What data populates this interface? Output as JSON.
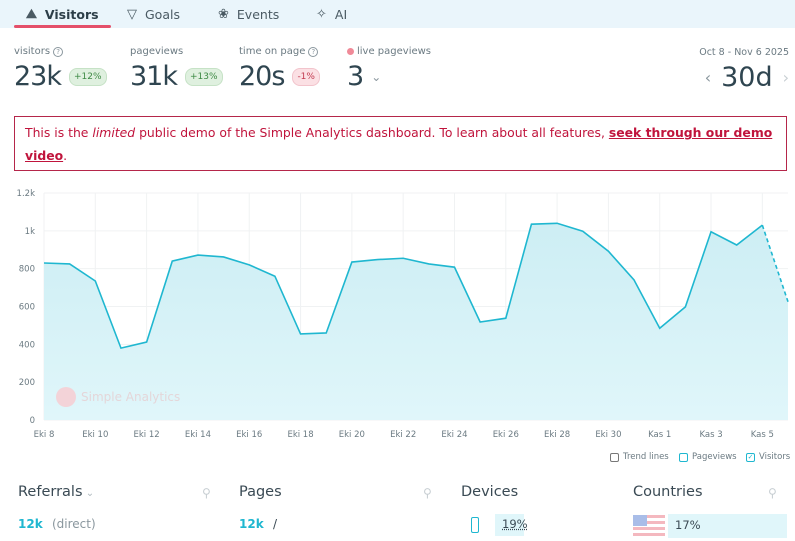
{
  "tabs": [
    {
      "label": "Visitors",
      "icon": "chart-icon",
      "active": true
    },
    {
      "label": "Goals",
      "icon": "filter-icon"
    },
    {
      "label": "Events",
      "icon": "paw-icon"
    },
    {
      "label": "AI",
      "icon": "magic-wand-icon"
    }
  ],
  "stats": {
    "visitors": {
      "label": "visitors",
      "value": "23k",
      "change": "+12%"
    },
    "pageviews": {
      "label": "pageviews",
      "value": "31k",
      "change": "+13%"
    },
    "time_on_page": {
      "label": "time on page",
      "value": "20s",
      "change": "-1%"
    },
    "live": {
      "label": "live pageviews",
      "value": "3"
    }
  },
  "date_range": {
    "label": "Oct 8 - Nov 6 2025",
    "period": "30d"
  },
  "banner": {
    "pre": "This is the ",
    "em": "limited",
    "mid": " public demo of the Simple Analytics dashboard. To learn about all features, ",
    "link": "seek through our demo video",
    "post": "."
  },
  "watermark": "Simple Analytics",
  "chart_data": {
    "type": "area",
    "x": [
      "Eki 8",
      "Eki 9",
      "Eki 10",
      "Eki 11",
      "Eki 12",
      "Eki 13",
      "Eki 14",
      "Eki 15",
      "Eki 16",
      "Eki 17",
      "Eki 18",
      "Eki 19",
      "Eki 20",
      "Eki 21",
      "Eki 22",
      "Eki 23",
      "Eki 24",
      "Eki 25",
      "Eki 26",
      "Eki 27",
      "Eki 28",
      "Eki 29",
      "Eki 30",
      "Eki 31",
      "Kas 1",
      "Kas 2",
      "Kas 3",
      "Kas 4",
      "Kas 5",
      "Kas 6"
    ],
    "series": [
      {
        "name": "Visitors",
        "values": [
          830,
          825,
          735,
          380,
          412,
          840,
          872,
          862,
          820,
          760,
          455,
          460,
          835,
          848,
          855,
          825,
          808,
          518,
          538,
          1035,
          1040,
          998,
          892,
          740,
          485,
          598,
          995,
          925,
          1030,
          625
        ]
      }
    ],
    "x_tick_labels": [
      "Eki 8",
      "Eki 10",
      "Eki 12",
      "Eki 14",
      "Eki 16",
      "Eki 18",
      "Eki 20",
      "Eki 22",
      "Eki 24",
      "Eki 26",
      "Eki 28",
      "Eki 30",
      "Kas 1",
      "Kas 3",
      "Kas 5"
    ],
    "y_tick_labels": [
      "0",
      "200",
      "400",
      "600",
      "800",
      "1k",
      "1.2k"
    ],
    "ylim": [
      0,
      1200
    ],
    "grid": true,
    "last_segment_dashed": true,
    "color": "#1fb7d0"
  },
  "legend": [
    {
      "label": "Trend lines",
      "checked": false
    },
    {
      "label": "Pageviews",
      "checked": false
    },
    {
      "label": "Visitors",
      "checked": true
    }
  ],
  "panels": {
    "referrals": {
      "title": "Referrals",
      "count": "12k",
      "item": "(direct)"
    },
    "pages": {
      "title": "Pages",
      "count": "12k",
      "item": "/"
    },
    "devices": {
      "title": "Devices",
      "percent": "19%",
      "icon": "mobile-icon"
    },
    "countries": {
      "title": "Countries",
      "percent": "17%",
      "icon": "us-flag-icon"
    }
  }
}
